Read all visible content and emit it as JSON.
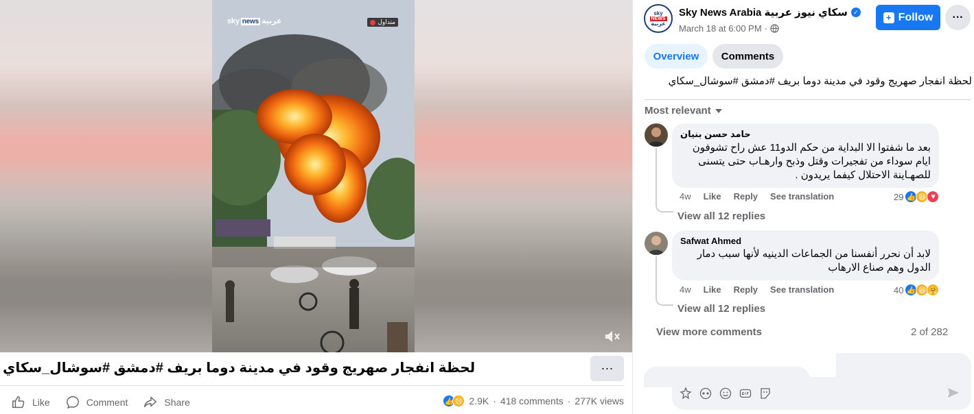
{
  "video": {
    "watermark_brand": "sky",
    "watermark_news": "news",
    "watermark_arabic": "عربية",
    "trend_badge": "متداول",
    "mute_icon": "muted-speaker-icon"
  },
  "post": {
    "caption": "لحظة انفجار صهريج وقود في مدينة دوما بريف #دمشق #سوشال_سكاي",
    "actions": {
      "like": "Like",
      "comment": "Comment",
      "share": "Share"
    },
    "stats": {
      "reactions": "2.9K",
      "comments": "418 comments",
      "views": "277K views"
    }
  },
  "page": {
    "name": "Sky News Arabia سكاي نيوز عربية",
    "timestamp": "March 18 at 6:00 PM",
    "follow_label": "Follow",
    "avatar_top": "sky",
    "avatar_mid": "NEWS",
    "avatar_bottom": "عربية"
  },
  "tabs": {
    "overview": "Overview",
    "comments": "Comments"
  },
  "post_text": "لحظة انفجار صهريج وقود في مدينة دوما بريف #دمشق #سوشال_سكاي",
  "sort_label": "Most relevant",
  "comments": [
    {
      "author": "حامد حسن بنيان",
      "lines": [
        "بعد ما شفتوا الا البداية من حكم الدو11 عش راح تشوفون",
        "ايام سوداء من تفجيرات وقتل وذبح وارهـاب حتى يتسنى",
        "للصهـاينة الاحتلال كيفما يريدون ."
      ],
      "time": "4w",
      "like": "Like",
      "reply": "Reply",
      "translate": "See translation",
      "reactions": "29",
      "replies": "View all 12 replies"
    },
    {
      "author": "Safwat Ahmed",
      "lines": [
        "لابد أن نحرر أنفسنا من الجماعات الدينيه لأنها سبب دمار",
        "الدول وهم صناع الارهاب"
      ],
      "time": "4w",
      "like": "Like",
      "reply": "Reply",
      "translate": "See translation",
      "reactions": "40",
      "replies": "View all 12 replies"
    }
  ],
  "view_more": "View more comments",
  "page_count": "2 of 282",
  "colors": {
    "accent": "#1877f2",
    "secondary_text": "#65676b",
    "bubble": "#f0f2f5"
  }
}
